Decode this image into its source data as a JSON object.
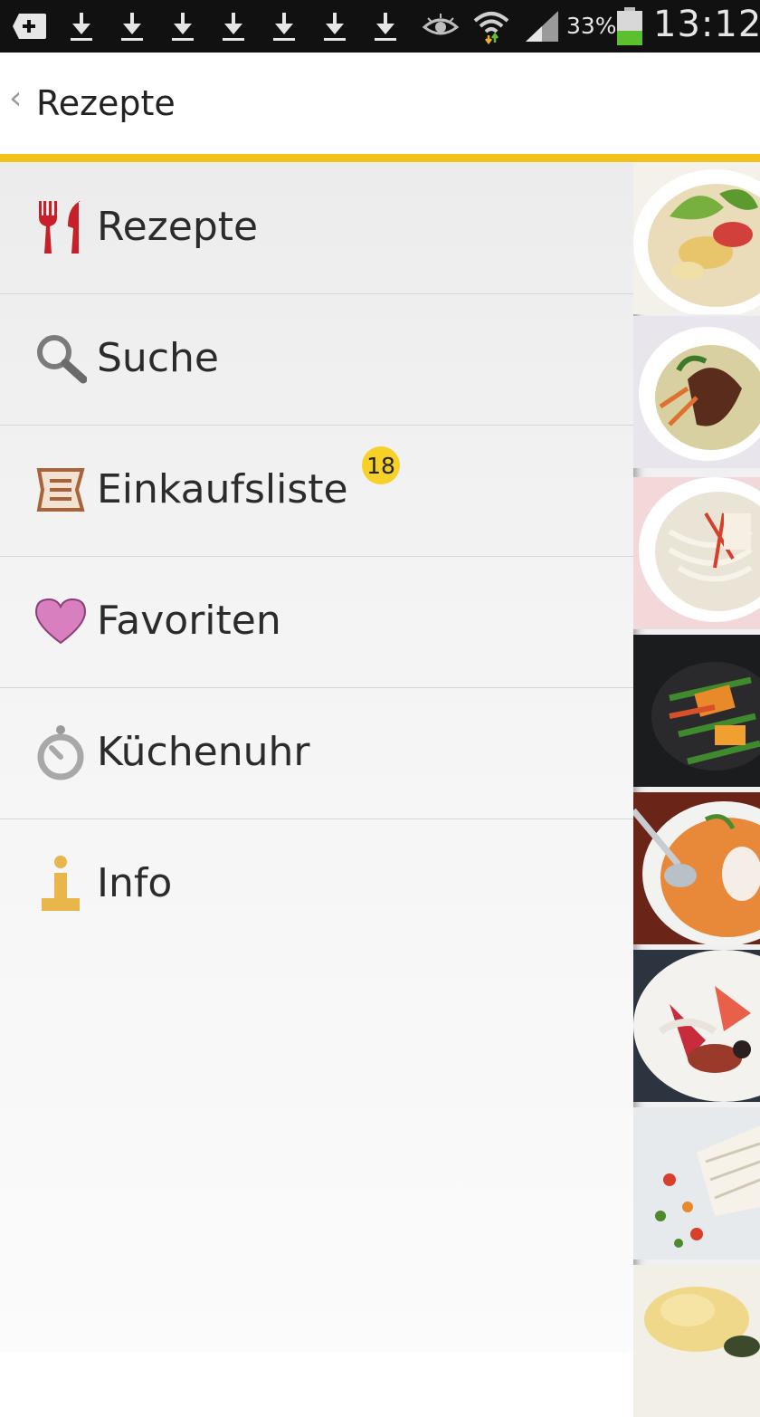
{
  "status_bar": {
    "battery_percent": "33%",
    "time": "13:12",
    "icons": [
      "add-notification-icon",
      "download-icon",
      "download-icon",
      "download-icon",
      "download-icon",
      "download-icon",
      "download-icon",
      "download-icon",
      "eye-icon",
      "wifi-icon",
      "signal-icon",
      "battery-icon"
    ],
    "battery_level": 0.33
  },
  "action_bar": {
    "back_glyph": "‹",
    "title": "Rezepte"
  },
  "menu": {
    "items": [
      {
        "label": "Rezepte",
        "icon": "fork-knife-icon"
      },
      {
        "label": "Suche",
        "icon": "search-icon"
      },
      {
        "label": "Einkaufsliste",
        "icon": "list-icon",
        "badge": "18"
      },
      {
        "label": "Favoriten",
        "icon": "heart-icon"
      },
      {
        "label": "Küchenuhr",
        "icon": "timer-icon"
      },
      {
        "label": "Info",
        "icon": "info-icon"
      }
    ]
  },
  "colors": {
    "accent": "#f2c21a",
    "badge": "#f7d028",
    "fork_knife": "#c8202a",
    "heart": "#d77fbf",
    "list": "#a9623a",
    "info": "#e8b64a"
  },
  "thumbnails": [
    {
      "icon": "salad-image"
    },
    {
      "icon": "stirfry-bowl-image"
    },
    {
      "icon": "noodle-soup-image"
    },
    {
      "icon": "wok-vegetables-image"
    },
    {
      "icon": "soup-spoon-image"
    },
    {
      "icon": "plate-salad-image"
    },
    {
      "icon": "fish-vegetables-image"
    },
    {
      "icon": "mashed-potato-image"
    }
  ]
}
